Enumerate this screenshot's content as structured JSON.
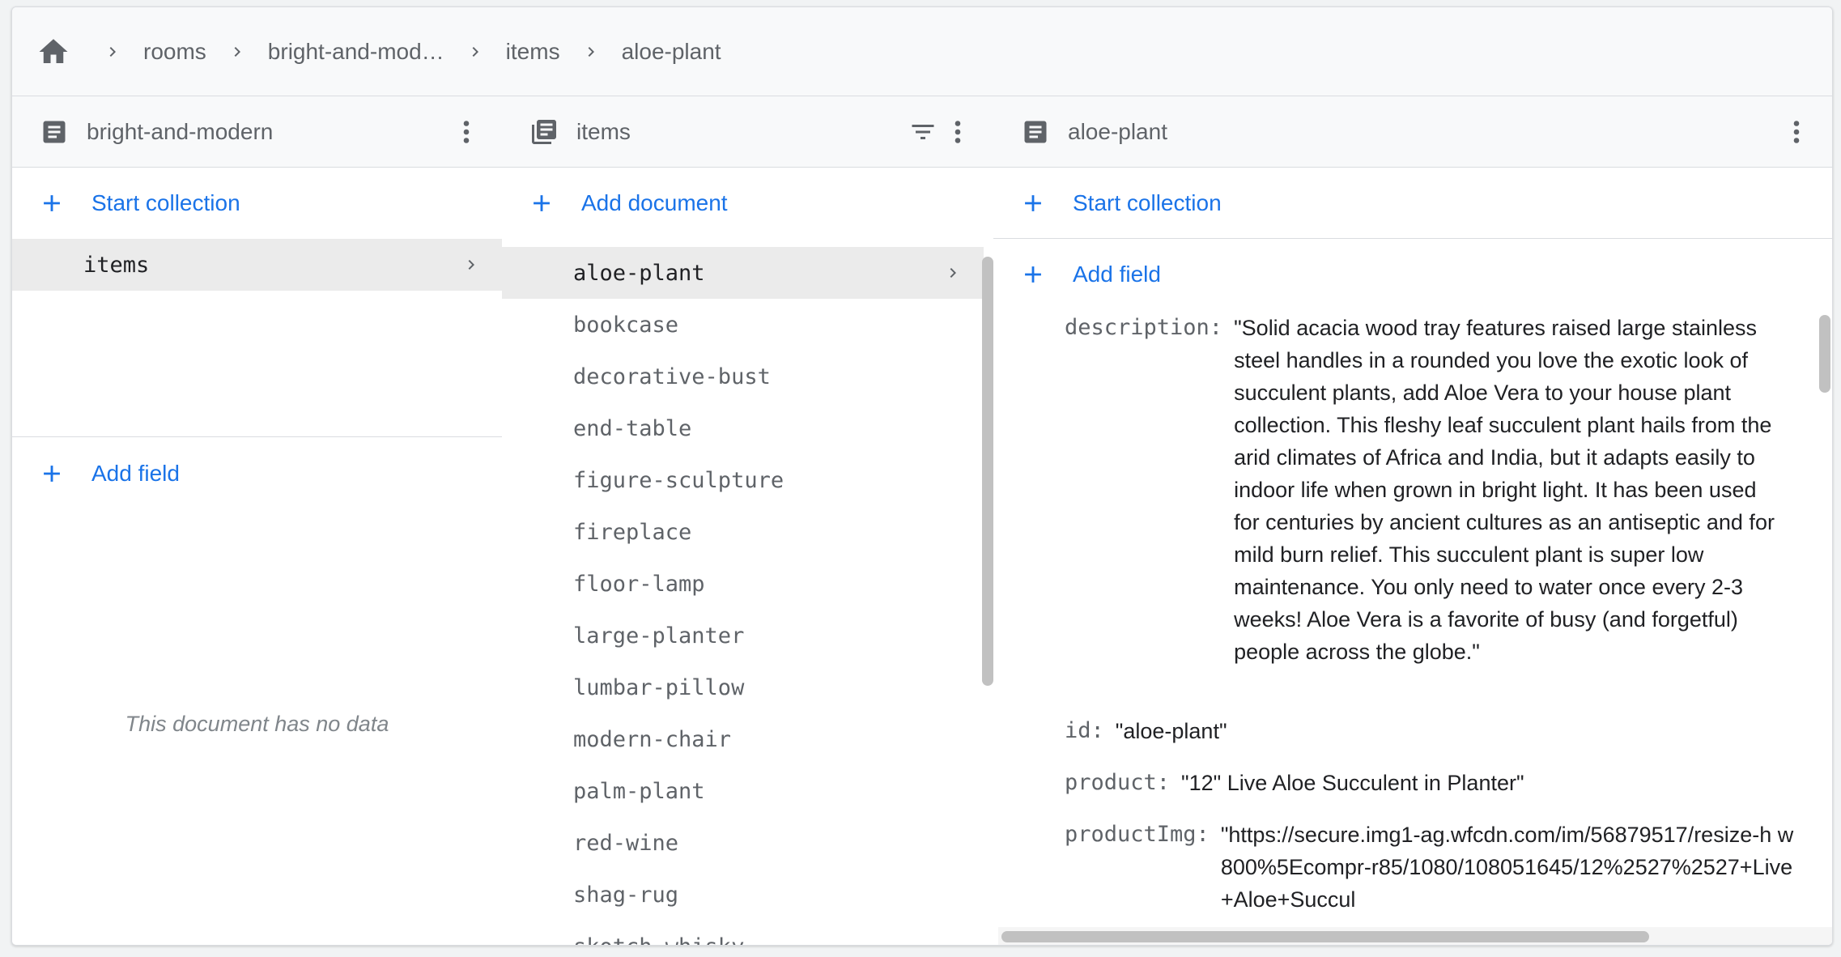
{
  "breadcrumb": {
    "items": [
      "rooms",
      "bright-and-mod…",
      "items",
      "aloe-plant"
    ]
  },
  "panel_doc": {
    "title": "bright-and-modern",
    "start_collection": "Start collection",
    "collections": [
      {
        "label": "items"
      }
    ],
    "add_field": "Add field",
    "empty_text": "This document has no data"
  },
  "panel_collection": {
    "title": "items",
    "add_document": "Add document",
    "documents": [
      "aloe-plant",
      "bookcase",
      "decorative-bust",
      "end-table",
      "figure-sculpture",
      "fireplace",
      "floor-lamp",
      "large-planter",
      "lumbar-pillow",
      "modern-chair",
      "palm-plant",
      "red-wine",
      "shag-rug",
      "skotch-whisky"
    ],
    "selected": "aloe-plant"
  },
  "panel_fields": {
    "title": "aloe-plant",
    "start_collection": "Start collection",
    "add_field": "Add field",
    "fields": {
      "description_key": "description:",
      "description_val": "\"Solid acacia wood tray features raised large stainless steel handles in a rounded you love the exotic look of succulent plants, add Aloe Vera to your house plant collection. This fleshy leaf succulent plant hails from the arid climates of Africa and India, but it adapts easily to indoor life when grown in bright light. It has been used for centuries by ancient cultures as an antiseptic and for mild burn relief. This succulent plant is super low maintenance. You only need to water once every 2-3 weeks! Aloe Vera is a favorite of busy (and forgetful) people across the globe.\"",
      "id_key": "id:",
      "id_val": "\"aloe-plant\"",
      "product_key": "product:",
      "product_val": "\"12\" Live Aloe Succulent in Planter\"",
      "productImg_key": "productImg:",
      "productImg_val": "\"https://secure.img1-ag.wfcdn.com/im/56879517/resize-h w800%5Ecompr-r85/1080/108051645/12%2527%2527+Live+Aloe+Succul"
    }
  },
  "colors": {
    "accent": "#1a73e8",
    "muted_text": "#5f6368",
    "selected_row": "#ebebeb",
    "header_bg": "#f8f9fa"
  }
}
